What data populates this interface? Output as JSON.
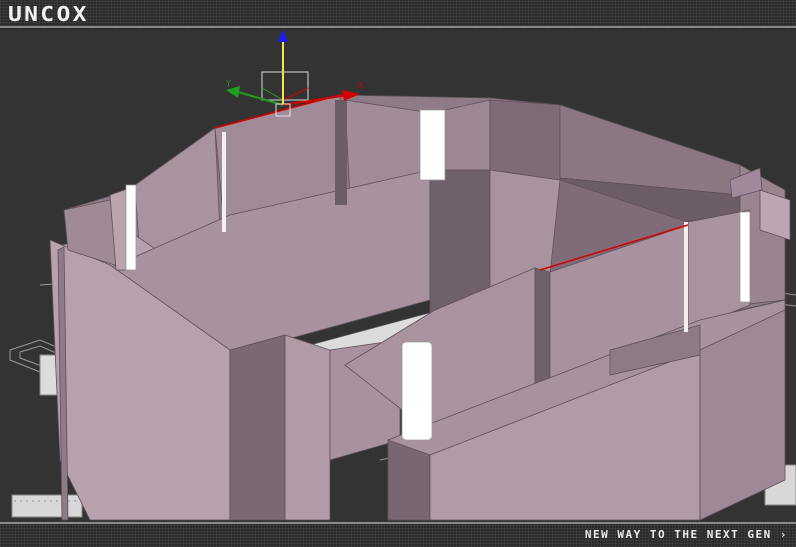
{
  "header": {
    "logo_text": "UNCOX"
  },
  "viewport": {
    "gizmo": {
      "x_label": "X",
      "y_label": "Y",
      "x_color": "#d40000",
      "y_color": "#1f9e1f",
      "z_color": "#1a1aff"
    },
    "model_color": "#a8929f",
    "background_color": "#333333"
  },
  "footer": {
    "tagline": "NEW WAY TO THE NEXT GEN ›"
  }
}
